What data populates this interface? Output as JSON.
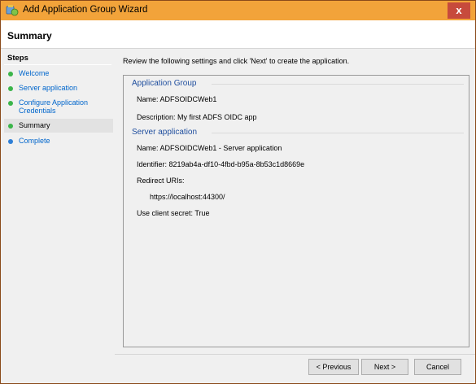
{
  "window": {
    "title": "Add Application Group Wizard",
    "close_label": "x"
  },
  "header": {
    "title": "Summary"
  },
  "steps": {
    "heading": "Steps",
    "items": [
      {
        "label": "Welcome",
        "dot_color": "#3bb54a"
      },
      {
        "label": "Server application",
        "dot_color": "#3bb54a"
      },
      {
        "label": "Configure Application Credentials",
        "dot_color": "#3bb54a"
      },
      {
        "label": "Summary",
        "dot_color": "#3bb54a"
      },
      {
        "label": "Complete",
        "dot_color": "#2f7fd6"
      }
    ]
  },
  "content": {
    "intro": "Review the following settings and click 'Next' to create the application.",
    "app_group": {
      "title": "Application Group",
      "name": "Name: ADFSOIDCWeb1",
      "description": "Description: My first ADFS OIDC app"
    },
    "server_app": {
      "title": "Server application",
      "name": "Name: ADFSOIDCWeb1 - Server application",
      "identifier": "Identifier: 8219ab4a-df10-4fbd-b95a-8b53c1d8669e",
      "redirect_label": "Redirect URIs:",
      "redirect_uri": "https://localhost:44300/",
      "client_secret": "Use client secret: True"
    }
  },
  "buttons": {
    "previous": "< Previous",
    "next": "Next >",
    "cancel": "Cancel"
  },
  "colors": {
    "title_bar": "#f2a33a",
    "link": "#0066cc",
    "section_title": "#1f4e9e"
  }
}
